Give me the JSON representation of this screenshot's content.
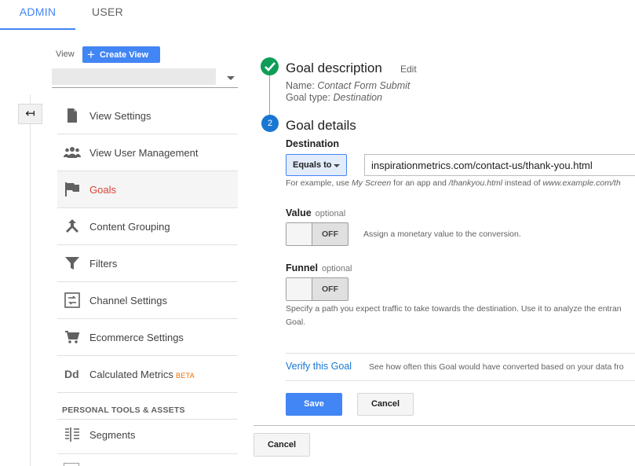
{
  "tabs": [
    {
      "label": "ADMIN",
      "active": true
    },
    {
      "label": "USER",
      "active": false
    }
  ],
  "view_picker": {
    "label": "View",
    "create_view_label": "Create View",
    "selected_value": ""
  },
  "nav": {
    "items": [
      {
        "label": "View Settings",
        "icon": "document-icon"
      },
      {
        "label": "View User Management",
        "icon": "people-icon"
      },
      {
        "label": "Goals",
        "icon": "flag-icon",
        "active": true
      },
      {
        "label": "Content Grouping",
        "icon": "merge-arrow-icon"
      },
      {
        "label": "Filters",
        "icon": "filter-funnel-icon"
      },
      {
        "label": "Channel Settings",
        "icon": "channel-swap-icon"
      },
      {
        "label": "Ecommerce Settings",
        "icon": "cart-icon"
      },
      {
        "label": "Calculated Metrics",
        "icon": "dd-icon",
        "badge": "BETA"
      }
    ],
    "section_heading": "PERSONAL TOOLS & ASSETS",
    "section_items": [
      {
        "label": "Segments",
        "icon": "segments-icon"
      }
    ]
  },
  "goal": {
    "step1": {
      "title": "Goal description",
      "edit_label": "Edit",
      "name_label": "Name:",
      "name_value": "Contact Form Submit",
      "type_label": "Goal type:",
      "type_value": "Destination"
    },
    "step2": {
      "number": "2",
      "title": "Goal details",
      "destination_label": "Destination",
      "match_type": "Equals to",
      "destination_value": "inspirationmetrics.com/contact-us/thank-you.html",
      "example": {
        "prefix": "For example, use ",
        "app_example": "My Screen",
        "mid1": " for an app and ",
        "web_example": "/thankyou.html",
        "mid2": " instead of ",
        "domain_example": "www.example.com/th"
      },
      "value_label": "Value",
      "value_optional": "optional",
      "value_toggle": "OFF",
      "value_hint": "Assign a monetary value to the conversion.",
      "funnel_label": "Funnel",
      "funnel_optional": "optional",
      "funnel_toggle": "OFF",
      "funnel_help_line1": "Specify a path you expect traffic to take towards the destination. Use it to analyze the entran",
      "funnel_help_line2": "Goal."
    },
    "verify_link": "Verify this Goal",
    "verify_text": "See how often this Goal would have converted based on your data fro",
    "save_label": "Save",
    "cancel_label": "Cancel"
  },
  "footer": {
    "cancel_label": "Cancel"
  },
  "colors": {
    "accent": "#4285f4",
    "active_nav": "#db4437",
    "complete": "#0f9d58",
    "step": "#1976d2",
    "beta": "#ef6c00"
  }
}
